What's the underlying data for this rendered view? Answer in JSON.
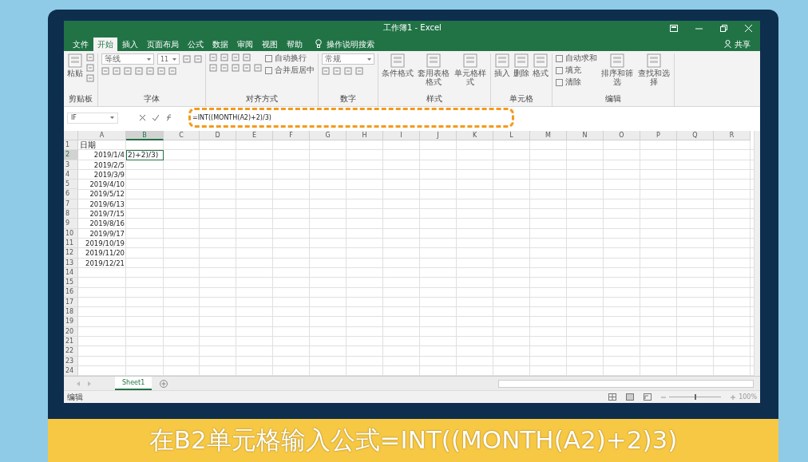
{
  "window": {
    "title": "工作簿1 - Excel"
  },
  "share": "共享",
  "tabs": [
    {
      "label": "文件",
      "selected": false
    },
    {
      "label": "开始",
      "selected": true
    },
    {
      "label": "插入",
      "selected": false
    },
    {
      "label": "页面布局",
      "selected": false
    },
    {
      "label": "公式",
      "selected": false
    },
    {
      "label": "数据",
      "selected": false
    },
    {
      "label": "审阅",
      "selected": false
    },
    {
      "label": "视图",
      "selected": false
    },
    {
      "label": "帮助",
      "selected": false
    }
  ],
  "tell_me": "操作说明搜索",
  "ribbon": [
    {
      "label": "剪贴板",
      "columns": [
        [
          [
            {
              "kind": "large",
              "text": "粘贴"
            }
          ]
        ],
        [
          [
            {
              "kind": "icon"
            }
          ],
          [
            {
              "kind": "icon"
            }
          ],
          [
            {
              "kind": "icon"
            }
          ]
        ]
      ]
    },
    {
      "label": "字体",
      "columns": [
        [
          [
            {
              "kind": "field",
              "text": "等线"
            },
            {
              "kind": "number_field",
              "text": "11"
            },
            {
              "kind": "icon"
            },
            {
              "kind": "icon"
            }
          ],
          [
            {
              "kind": "icon"
            },
            {
              "kind": "icon"
            },
            {
              "kind": "icon"
            },
            {
              "kind": "icon"
            },
            {
              "kind": "icon"
            },
            {
              "kind": "icon"
            },
            {
              "kind": "icon"
            }
          ]
        ]
      ]
    },
    {
      "label": "对齐方式",
      "columns": [
        [
          [
            {
              "kind": "icon"
            },
            {
              "kind": "icon"
            },
            {
              "kind": "icon"
            },
            {
              "kind": "icon"
            }
          ],
          [
            {
              "kind": "icon"
            },
            {
              "kind": "icon"
            },
            {
              "kind": "icon"
            },
            {
              "kind": "icon"
            },
            {
              "kind": "icon"
            }
          ]
        ],
        [
          [
            {
              "kind": "small",
              "text": "自动换行"
            }
          ],
          [
            {
              "kind": "small",
              "text": "合并后居中"
            }
          ]
        ]
      ]
    },
    {
      "label": "数字",
      "columns": [
        [
          [
            {
              "kind": "field",
              "text": "常规"
            }
          ],
          [
            {
              "kind": "icon"
            },
            {
              "kind": "icon"
            },
            {
              "kind": "icon"
            },
            {
              "kind": "icon"
            }
          ]
        ]
      ]
    },
    {
      "label": "样式",
      "columns": [
        [
          [
            {
              "kind": "large",
              "text": "条件格式"
            }
          ]
        ],
        [
          [
            {
              "kind": "large",
              "text": "套用表格格式"
            }
          ]
        ],
        [
          [
            {
              "kind": "large",
              "text": "单元格样式"
            }
          ]
        ]
      ]
    },
    {
      "label": "单元格",
      "columns": [
        [
          [
            {
              "kind": "large",
              "text": "插入"
            }
          ]
        ],
        [
          [
            {
              "kind": "large",
              "text": "删除"
            }
          ]
        ],
        [
          [
            {
              "kind": "large",
              "text": "格式"
            }
          ]
        ]
      ]
    },
    {
      "label": "编辑",
      "columns": [
        [
          [
            {
              "kind": "small",
              "text": "自动求和"
            }
          ],
          [
            {
              "kind": "small",
              "text": "填充"
            }
          ],
          [
            {
              "kind": "small",
              "text": "清除"
            }
          ]
        ],
        [
          [
            {
              "kind": "large",
              "text": "排序和筛选"
            }
          ]
        ],
        [
          [
            {
              "kind": "large",
              "text": "查找和选择"
            }
          ]
        ]
      ]
    }
  ],
  "name_box": "IF",
  "formula": "=INT((MONTH(A2)+2)/3)",
  "columns": [
    {
      "label": "A",
      "selected": false
    },
    {
      "label": "B",
      "selected": true
    },
    {
      "label": "C",
      "selected": false
    },
    {
      "label": "D",
      "selected": false
    },
    {
      "label": "E",
      "selected": false
    },
    {
      "label": "F",
      "selected": false
    },
    {
      "label": "G",
      "selected": false
    },
    {
      "label": "H",
      "selected": false
    },
    {
      "label": "I",
      "selected": false
    },
    {
      "label": "J",
      "selected": false
    },
    {
      "label": "K",
      "selected": false
    },
    {
      "label": "L",
      "selected": false
    },
    {
      "label": "M",
      "selected": false
    },
    {
      "label": "N",
      "selected": false
    },
    {
      "label": "O",
      "selected": false
    },
    {
      "label": "P",
      "selected": false
    },
    {
      "label": "Q",
      "selected": false
    },
    {
      "label": "R",
      "selected": false
    }
  ],
  "rows": [
    {
      "number": "1",
      "selected": false,
      "cells": [
        {
          "text": "日期",
          "kind": "text",
          "selected": false
        }
      ]
    },
    {
      "number": "2",
      "selected": true,
      "cells": [
        {
          "text": "2019/1/4",
          "kind": "date",
          "selected": false
        },
        {
          "text": "2)+2)/3)",
          "kind": "text",
          "selected": true
        }
      ]
    },
    {
      "number": "3",
      "selected": false,
      "cells": [
        {
          "text": "2019/2/5",
          "kind": "date",
          "selected": false
        }
      ]
    },
    {
      "number": "4",
      "selected": false,
      "cells": [
        {
          "text": "2019/3/9",
          "kind": "date",
          "selected": false
        }
      ]
    },
    {
      "number": "5",
      "selected": false,
      "cells": [
        {
          "text": "2019/4/10",
          "kind": "date",
          "selected": false
        }
      ]
    },
    {
      "number": "6",
      "selected": false,
      "cells": [
        {
          "text": "2019/5/12",
          "kind": "date",
          "selected": false
        }
      ]
    },
    {
      "number": "7",
      "selected": false,
      "cells": [
        {
          "text": "2019/6/13",
          "kind": "date",
          "selected": false
        }
      ]
    },
    {
      "number": "8",
      "selected": false,
      "cells": [
        {
          "text": "2019/7/15",
          "kind": "date",
          "selected": false
        }
      ]
    },
    {
      "number": "9",
      "selected": false,
      "cells": [
        {
          "text": "2019/8/16",
          "kind": "date",
          "selected": false
        }
      ]
    },
    {
      "number": "10",
      "selected": false,
      "cells": [
        {
          "text": "2019/9/17",
          "kind": "date",
          "selected": false
        }
      ]
    },
    {
      "number": "11",
      "selected": false,
      "cells": [
        {
          "text": "2019/10/19",
          "kind": "date",
          "selected": false
        }
      ]
    },
    {
      "number": "12",
      "selected": false,
      "cells": [
        {
          "text": "2019/11/20",
          "kind": "date",
          "selected": false
        }
      ]
    },
    {
      "number": "13",
      "selected": false,
      "cells": [
        {
          "text": "2019/12/21",
          "kind": "date",
          "selected": false
        }
      ]
    },
    {
      "number": "14",
      "selected": false,
      "cells": []
    },
    {
      "number": "15",
      "selected": false,
      "cells": []
    },
    {
      "number": "16",
      "selected": false,
      "cells": []
    },
    {
      "number": "17",
      "selected": false,
      "cells": []
    },
    {
      "number": "18",
      "selected": false,
      "cells": []
    },
    {
      "number": "19",
      "selected": false,
      "cells": []
    },
    {
      "number": "20",
      "selected": false,
      "cells": []
    },
    {
      "number": "21",
      "selected": false,
      "cells": []
    },
    {
      "number": "22",
      "selected": false,
      "cells": []
    },
    {
      "number": "23",
      "selected": false,
      "cells": []
    },
    {
      "number": "24",
      "selected": false,
      "cells": []
    }
  ],
  "sheets": [
    {
      "label": "Sheet1",
      "selected": true
    }
  ],
  "status_bar": {
    "mode": "编辑",
    "zoom": "100%",
    "zoom_slider": {
      "level": 0.5
    }
  },
  "caption": "在B2单元格输入公式=INT((MONTH(A2)+2)3)"
}
